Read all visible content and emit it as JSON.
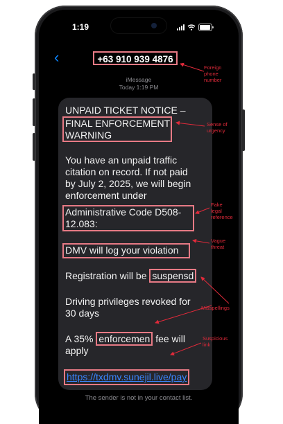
{
  "status_bar": {
    "time": "1:19"
  },
  "header": {
    "back_glyph": "‹",
    "contact": "+63 910 939 4876"
  },
  "meta": {
    "service": "iMessage",
    "timestamp": "Today 1:19 PM"
  },
  "message": {
    "line1": "UNPAID TICKET NOTICE –",
    "line2": "FINAL ENFORCEMENT",
    "line3": "WARNING",
    "para1": [
      "You have an unpaid traffic",
      "citation on record. If not paid",
      "by July 2, 2025, we will begin",
      "enforcement under"
    ],
    "legal1": "Administrative Code D508-",
    "legal2": "12.083:",
    "threat": "DMV will log your violation",
    "reg_prefix": "Registration will be ",
    "reg_misspelled": "suspensd",
    "privileges": [
      "Driving privileges revoked for",
      "30 days"
    ],
    "fee_prefix": "A 35% ",
    "fee_misspelled": "enforcemen",
    "fee_suffix": " fee will",
    "fee_line2": "apply",
    "link": "https://txdmv.sunejil.live/pay"
  },
  "footer": {
    "note": "The sender is not in your contact list."
  },
  "annotations": {
    "foreign_phone": [
      "Foreign",
      "phone",
      "number"
    ],
    "urgency": [
      "Sense of",
      "urgency"
    ],
    "fake_legal": [
      "Fake",
      "legal",
      "reference"
    ],
    "vague_threat": [
      "Vague",
      "threat"
    ],
    "misspellings": [
      "Misspellings"
    ],
    "suspicious_link": [
      "Suspicious",
      "link"
    ]
  },
  "colors": {
    "annotation": "#e02a3a",
    "highlight_box": "#e77a85",
    "link": "#3a86ff",
    "bubble": "#26262a"
  },
  "icons": [
    "back-chevron-icon",
    "signal-icon",
    "wifi-icon",
    "battery-icon"
  ]
}
